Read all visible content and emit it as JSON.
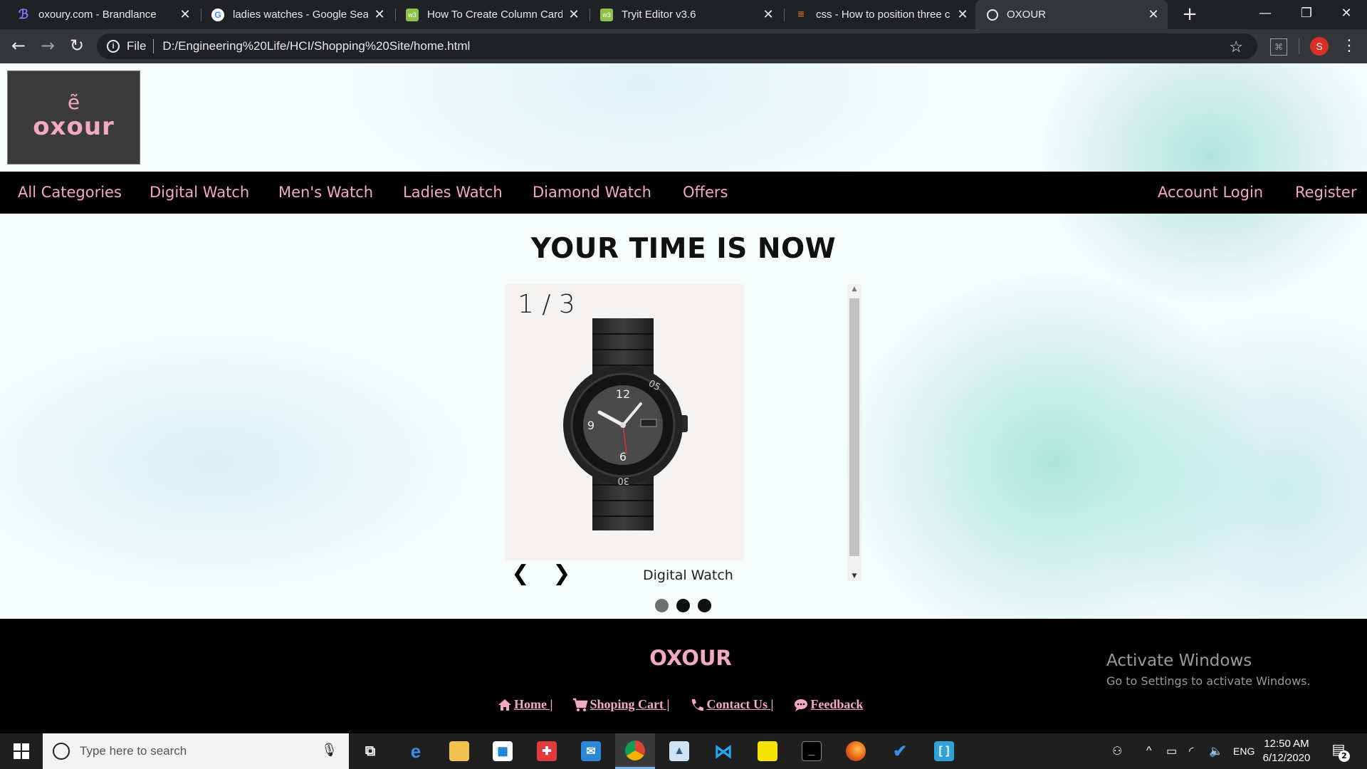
{
  "browser": {
    "tabs": [
      {
        "title": "oxoury.com - Brandlance",
        "favicon": "brandlance-icon",
        "close": "✕"
      },
      {
        "title": "ladies watches - Google Sear",
        "favicon": "google-icon",
        "close": "✕"
      },
      {
        "title": "How To Create Column Card",
        "favicon": "w3schools-icon",
        "close": "✕"
      },
      {
        "title": "Tryit Editor v3.6",
        "favicon": "w3schools-icon",
        "close": "✕"
      },
      {
        "title": "css - How to position three c",
        "favicon": "stackoverflow-icon",
        "close": "✕"
      },
      {
        "title": "OXOUR",
        "favicon": "globe-icon",
        "close": "✕",
        "active": true
      }
    ],
    "new_tab": "+",
    "address": {
      "scheme_label": "File",
      "url": "D:/Engineering%20Life/HCI/Shopping%20Site/home.html"
    },
    "profile_initial": "S",
    "window_controls": {
      "minimize": "—",
      "restore": "❐",
      "close": "✕"
    }
  },
  "site": {
    "logo_mark": "ẽ",
    "logo_text": "oxour",
    "nav_left": [
      "All Categories",
      "Digital Watch",
      "Men's Watch",
      "Ladies Watch",
      "Diamond Watch",
      "Offers"
    ],
    "nav_right": [
      "Account Login",
      "Register"
    ],
    "hero_title": "YOUR TIME IS NOW",
    "slider": {
      "counter": "1 / 3",
      "caption": "Digital Watch",
      "prev": "❮",
      "next": "❯",
      "total_slides": 3,
      "active_slide": 1
    },
    "footer": {
      "brand": "OXOUR",
      "links": [
        {
          "label": "Home |",
          "icon": "home-icon"
        },
        {
          "label": "Shoping Cart |",
          "icon": "cart-icon"
        },
        {
          "label": "Contact Us |",
          "icon": "phone-icon"
        },
        {
          "label": "Feedback",
          "icon": "comment-icon"
        }
      ]
    },
    "watermark": {
      "line1": "Activate Windows",
      "line2": "Go to Settings to activate Windows."
    },
    "colors": {
      "brand_pink": "#f4a9c3",
      "nav_bg": "#000000"
    }
  },
  "taskbar": {
    "search_placeholder": "Type here to search",
    "language": "ENG",
    "time": "12:50 AM",
    "date": "6/12/2020",
    "notification_count": "2"
  }
}
